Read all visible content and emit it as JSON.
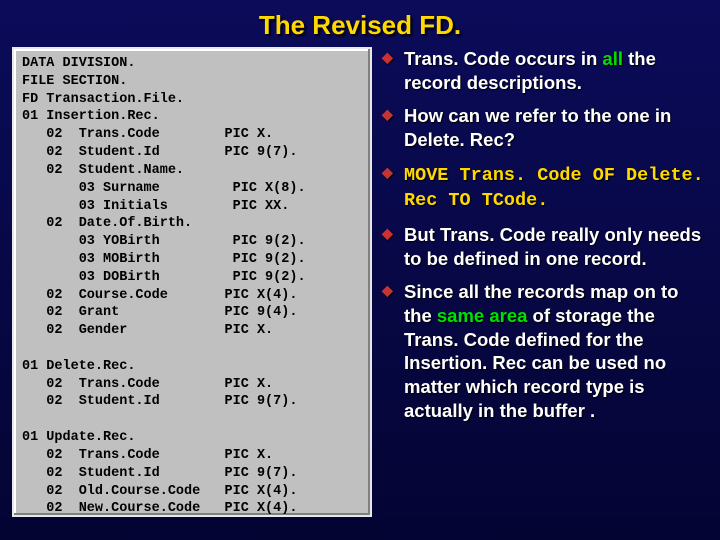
{
  "title": "The Revised FD.",
  "code": "DATA DIVISION.\nFILE SECTION.\nFD Transaction.File.\n01 Insertion.Rec.\n   02  Trans.Code        PIC X.\n   02  Student.Id        PIC 9(7).\n   02  Student.Name.\n       03 Surname         PIC X(8).\n       03 Initials        PIC XX.\n   02  Date.Of.Birth.\n       03 YOBirth         PIC 9(2).\n       03 MOBirth         PIC 9(2).\n       03 DOBirth         PIC 9(2).\n   02  Course.Code       PIC X(4).\n   02  Grant             PIC 9(4).\n   02  Gender            PIC X.\n\n01 Delete.Rec.\n   02  Trans.Code        PIC X.\n   02  Student.Id        PIC 9(7).\n\n01 Update.Rec.\n   02  Trans.Code        PIC X.\n   02  Student.Id        PIC 9(7).\n   02  Old.Course.Code   PIC X(4).\n   02  New.Course.Code   PIC X(4).",
  "bullets": {
    "b1a": "Trans. Code occurs in ",
    "b1b": "all",
    "b1c": " the record descriptions.",
    "b2": "How can we refer to the one in Delete. Rec?",
    "b3": "MOVE Trans. Code OF Delete. Rec TO TCode.",
    "b4": "But Trans. Code really only needs to be defined in one record.",
    "b5a": "Since all the records map on to the ",
    "b5b": "same area",
    "b5c": " of storage the Trans. Code defined for the Insertion. Rec can be used no matter which record type is actually in the buffer ."
  }
}
